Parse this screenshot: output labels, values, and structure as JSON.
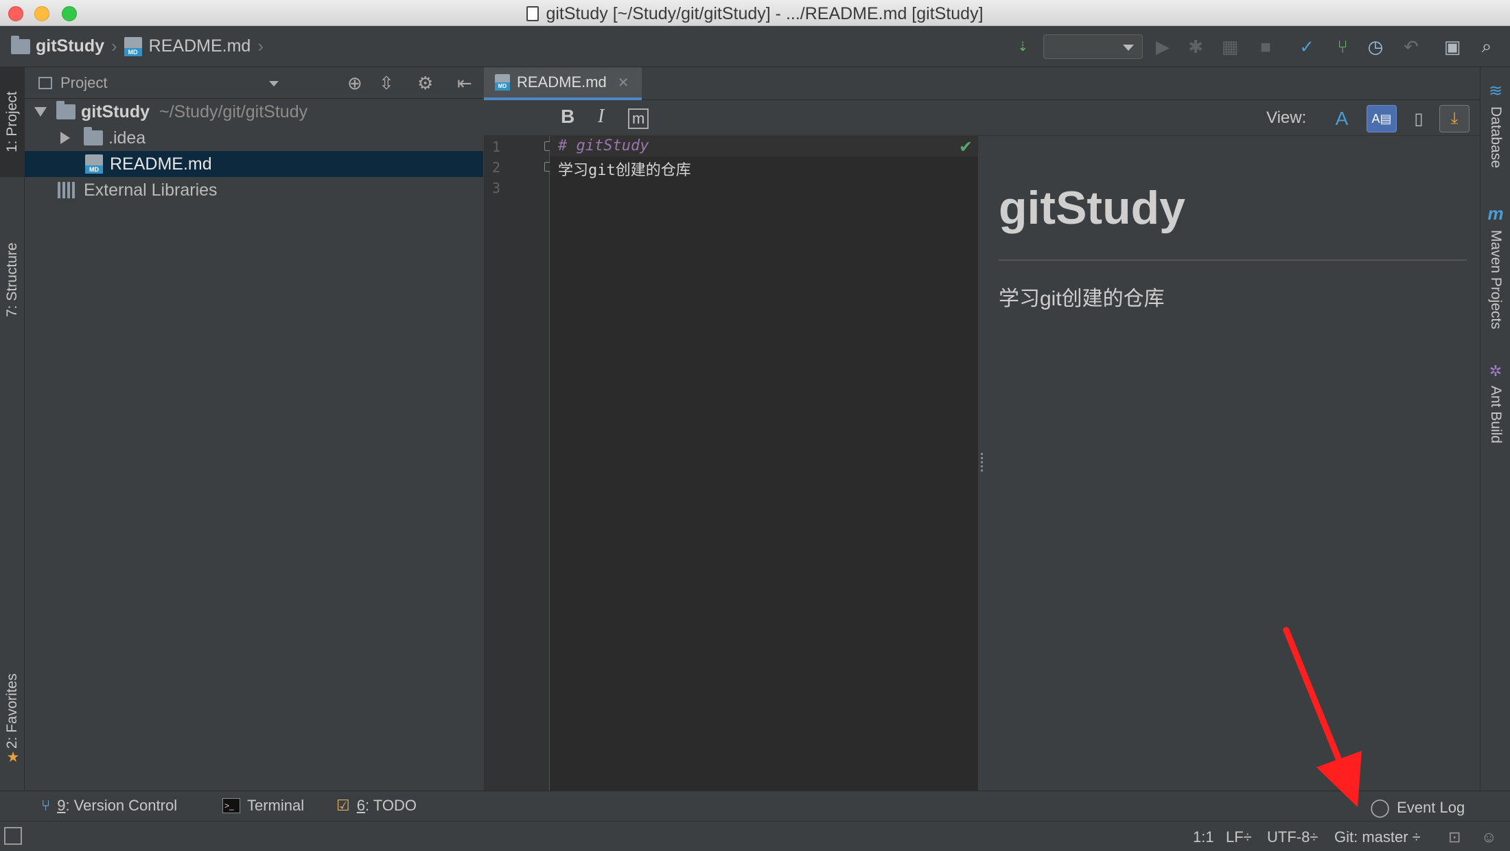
{
  "window": {
    "title": "gitStudy [~/Study/git/gitStudy] - .../README.md [gitStudy]"
  },
  "breadcrumb": {
    "project": "gitStudy",
    "file": "README.md"
  },
  "left_stripe": {
    "tabs": [
      "1: Project",
      "7: Structure",
      "2: Favorites"
    ]
  },
  "right_stripe": {
    "tabs": [
      "Database",
      "Maven Projects",
      "Ant Build"
    ]
  },
  "project_panel": {
    "title": "Project",
    "tree": [
      {
        "name": "gitStudy",
        "path": "~/Study/git/gitStudy"
      },
      {
        "name": ".idea"
      },
      {
        "name": "README.md"
      },
      {
        "name": "External Libraries"
      }
    ]
  },
  "editor": {
    "tab_label": "README.md",
    "toolbar": {
      "bold": "B",
      "italic": "I",
      "code": "m",
      "view_label": "View:"
    },
    "line_numbers": [
      "1",
      "2",
      "3"
    ],
    "lines": [
      "# gitStudy",
      "学习git创建的仓库",
      ""
    ]
  },
  "preview": {
    "heading": "gitStudy",
    "paragraph": "学习git创建的仓库"
  },
  "bottom_tools": {
    "version_control": {
      "key": "9",
      "label": ": Version Control"
    },
    "terminal": {
      "label": "Terminal"
    },
    "todo": {
      "key": "6",
      "label": ": TODO"
    },
    "event_log": "Event Log"
  },
  "status": {
    "position": "1:1",
    "line_sep": "LF÷",
    "encoding": "UTF-8÷",
    "git_branch": "Git: master ÷"
  },
  "colors": {
    "accent": "#4a88c7",
    "selection": "#0d293e",
    "annotation_arrow": "#ff1f1f"
  }
}
